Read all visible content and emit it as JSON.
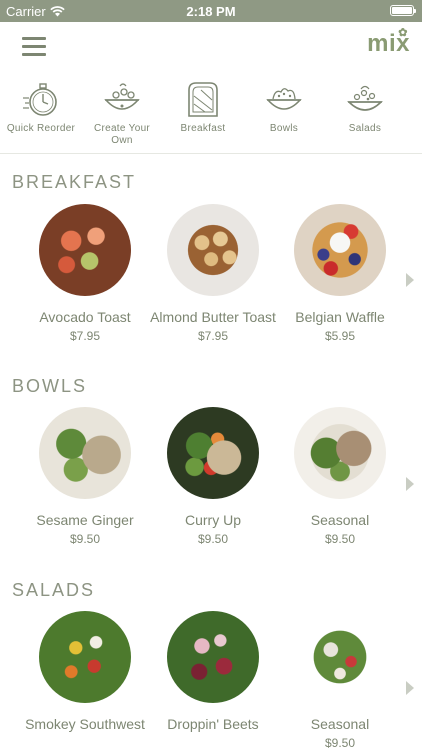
{
  "status_bar": {
    "carrier": "Carrier",
    "time": "2:18 PM"
  },
  "header": {
    "logo": "mix"
  },
  "categories": [
    {
      "label": "Quick Reorder",
      "icon": "stopwatch-icon"
    },
    {
      "label": "Create Your Own",
      "icon": "salad-bowl-icon"
    },
    {
      "label": "Breakfast",
      "icon": "toast-icon"
    },
    {
      "label": "Bowls",
      "icon": "grain-bowl-icon"
    },
    {
      "label": "Salads",
      "icon": "salad-icon"
    }
  ],
  "sections": [
    {
      "title": "BREAKFAST",
      "items": [
        {
          "name": "Avocado Toast",
          "price": "$7.95"
        },
        {
          "name": "Almond Butter Toast",
          "price": "$7.95"
        },
        {
          "name": "Belgian Waffle",
          "price": "$5.95"
        }
      ]
    },
    {
      "title": "BOWLS",
      "items": [
        {
          "name": "Sesame Ginger",
          "price": "$9.50"
        },
        {
          "name": "Curry Up",
          "price": "$9.50"
        },
        {
          "name": "Seasonal",
          "price": "$9.50"
        }
      ]
    },
    {
      "title": "SALADS",
      "items": [
        {
          "name": "Smokey Southwest",
          "price": ""
        },
        {
          "name": "Droppin' Beets",
          "price": ""
        },
        {
          "name": "Seasonal",
          "price": "$9.50"
        }
      ]
    }
  ],
  "colors": {
    "status_bar": "#8f9984",
    "text": "#7d8672",
    "accent": "#8a9b73"
  }
}
